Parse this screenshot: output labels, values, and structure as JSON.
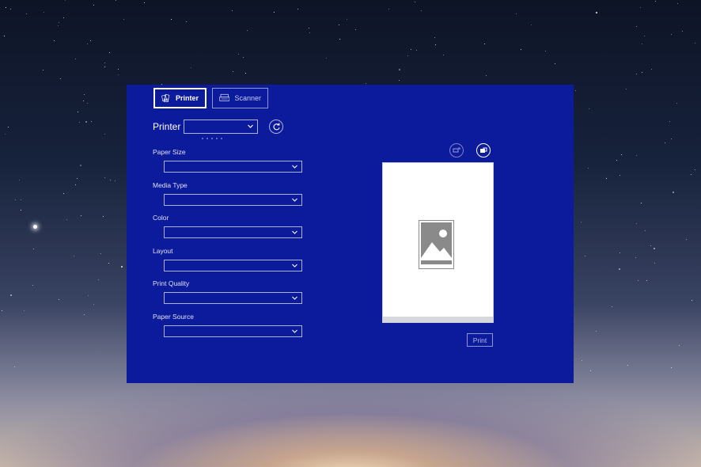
{
  "tabs": {
    "printer": "Printer",
    "scanner": "Scanner"
  },
  "printer_row": {
    "label": "Printer",
    "selected": ""
  },
  "fields": [
    {
      "label": "Paper Size",
      "value": ""
    },
    {
      "label": "Media Type",
      "value": ""
    },
    {
      "label": "Color",
      "value": ""
    },
    {
      "label": "Layout",
      "value": ""
    },
    {
      "label": "Print Quality",
      "value": ""
    },
    {
      "label": "Paper Source",
      "value": ""
    }
  ],
  "actions": {
    "print": "Print"
  },
  "colors": {
    "window_bg": "#0c1a9c",
    "border": "#aeb3dd",
    "text": "#ffffff"
  }
}
